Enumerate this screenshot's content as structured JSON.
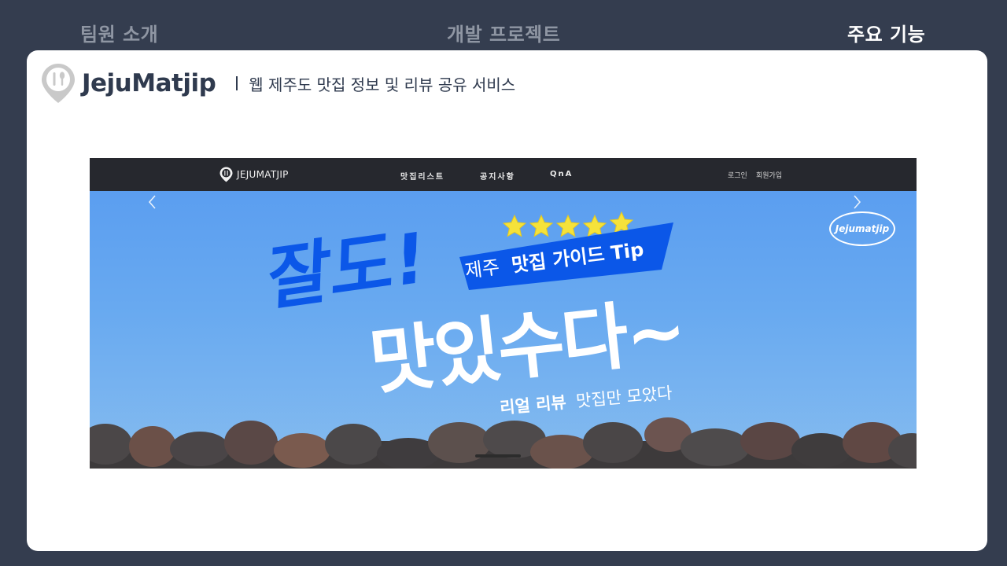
{
  "top_nav": {
    "tabs": [
      {
        "label": "팀원 소개",
        "active": false
      },
      {
        "label": "개발 프로젝트",
        "active": false
      },
      {
        "label": "주요 기능",
        "active": true
      }
    ]
  },
  "card": {
    "logo_text": "JejuMatjip",
    "subtitle": "웹 제주도 맛집 정보 및 리뷰 공유 서비스"
  },
  "site": {
    "logo_text": "JEJUMATJIP",
    "menu": [
      "맛집리스트",
      "공지사항",
      "QnA"
    ],
    "auth": {
      "login": "로그인",
      "signup": "회원가입"
    }
  },
  "hero": {
    "headline_top": "잘도!",
    "headline_main": "맛있수다~",
    "ribbon_prefix": "제주",
    "ribbon_bold": "맛집 가이드 Tip",
    "tagline_bold": "리얼 리뷰",
    "tagline_rest": "맛집만 모았다",
    "badge": "Jejumatjip",
    "stars": 5
  },
  "colors": {
    "page_bg": "#343d4f",
    "brand_dark": "#2f3a4e",
    "site_bar": "#26282e",
    "sky": "#5b9ef0",
    "ribbon_blue": "#0b57e8",
    "star_yellow": "#f5e23a"
  },
  "icons": {
    "brand_pin": "location-pin-fork-spoon-icon",
    "prev": "chevron-left-icon",
    "next": "chevron-right-icon"
  }
}
